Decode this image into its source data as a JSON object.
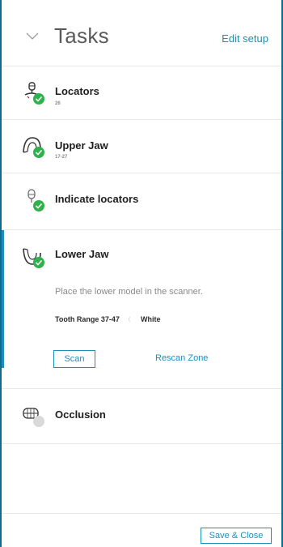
{
  "header": {
    "title": "Tasks",
    "edit_label": "Edit setup"
  },
  "tasks": [
    {
      "name": "Locators",
      "sub": "26",
      "status": "complete",
      "icon": "locator-icon"
    },
    {
      "name": "Upper Jaw",
      "sub": "17-27",
      "status": "complete",
      "icon": "upper-jaw-icon"
    },
    {
      "name": "Indicate locators",
      "sub": "",
      "status": "complete",
      "icon": "indicate-locator-icon"
    },
    {
      "name": "Lower Jaw",
      "sub": "",
      "status": "complete",
      "icon": "lower-jaw-icon",
      "active": true,
      "description": "Place the lower model in the scanner.",
      "tooth_range": "Tooth Range 37-47",
      "shade": "White",
      "scan_label": "Scan",
      "rescan_label": "Rescan Zone"
    },
    {
      "name": "Occlusion",
      "sub": "",
      "status": "pending",
      "icon": "occlusion-icon"
    }
  ],
  "footer": {
    "save_label": "Save & Close"
  },
  "colors": {
    "accent": "#1d8fb8",
    "frame": "#0f6c8c",
    "complete": "#2fb24c",
    "pending": "#d9d9d9"
  }
}
